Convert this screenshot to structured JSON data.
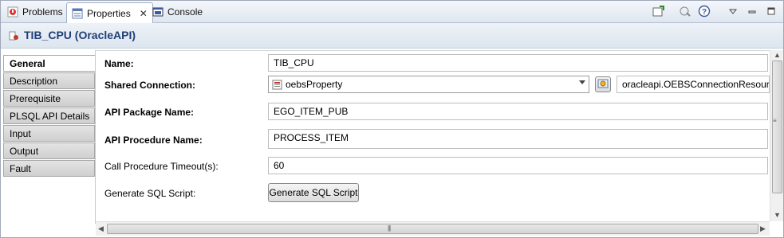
{
  "tabs": [
    {
      "label": "Problems",
      "icon": "problems-icon"
    },
    {
      "label": "Properties",
      "icon": "properties-icon",
      "active": true,
      "close": "✕"
    },
    {
      "label": "Console",
      "icon": "console-icon"
    }
  ],
  "toolbar": {
    "icons": [
      "pin-editor-icon",
      "sync-icon",
      "help-icon",
      "view-menu-icon",
      "minimize-icon",
      "maximize-icon"
    ]
  },
  "title": "TIB_CPU (OracleAPI)",
  "sidebar": {
    "items": [
      {
        "label": "General",
        "active": true
      },
      {
        "label": "Description"
      },
      {
        "label": "Prerequisite"
      },
      {
        "label": "PLSQL API Details"
      },
      {
        "label": "Input"
      },
      {
        "label": "Output"
      },
      {
        "label": "Fault"
      }
    ]
  },
  "form": {
    "name_label": "Name:",
    "name_value": "TIB_CPU",
    "shared_conn_label": "Shared Connection:",
    "shared_conn_value": "oebsProperty",
    "shared_conn_resource": "oracleapi.OEBSConnectionResource",
    "package_label": "API Package Name:",
    "package_value": "EGO_ITEM_PUB",
    "procedure_label": "API Procedure Name:",
    "procedure_value": "PROCESS_ITEM",
    "timeout_label": "Call Procedure Timeout(s):",
    "timeout_value": "60",
    "sql_label": "Generate SQL Script:",
    "sql_button": "Generate SQL Script"
  },
  "colors": {
    "title": "#1f3f77",
    "tab_border": "#9fb0c8"
  }
}
